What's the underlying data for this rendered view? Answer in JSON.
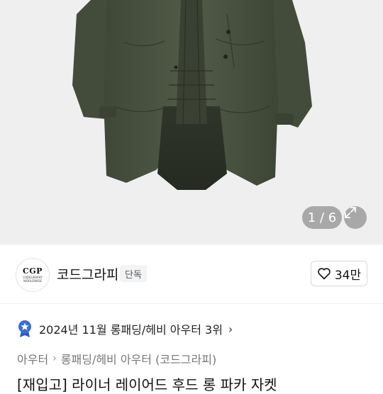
{
  "gallery": {
    "counter": "1 / 6",
    "expand_icon": "expand-icon"
  },
  "seller": {
    "logo_text": "CGP",
    "logo_subtext": "CODEGRAPHY WORLDWIDE",
    "name": "코드그라피",
    "badge": "단독",
    "like_icon": "heart-outline-icon",
    "like_count": "34만"
  },
  "ranking": {
    "medal_icon": "medal-star-icon",
    "text": "2024년 11월 롱패딩/헤비 아우터 3위",
    "chevron": "›"
  },
  "breadcrumb": {
    "items": [
      "아우터",
      "롱패딩/헤비 아우터 (코드그라피)"
    ],
    "separator": "›"
  },
  "product": {
    "title": "[재입고] 라이너 레이어드 후드 롱 파카 자켓"
  },
  "colors": {
    "primary_text": "#111111",
    "muted_text": "#777777",
    "medal_blue": "#3b6fd8",
    "product_green": "#4b5442"
  }
}
